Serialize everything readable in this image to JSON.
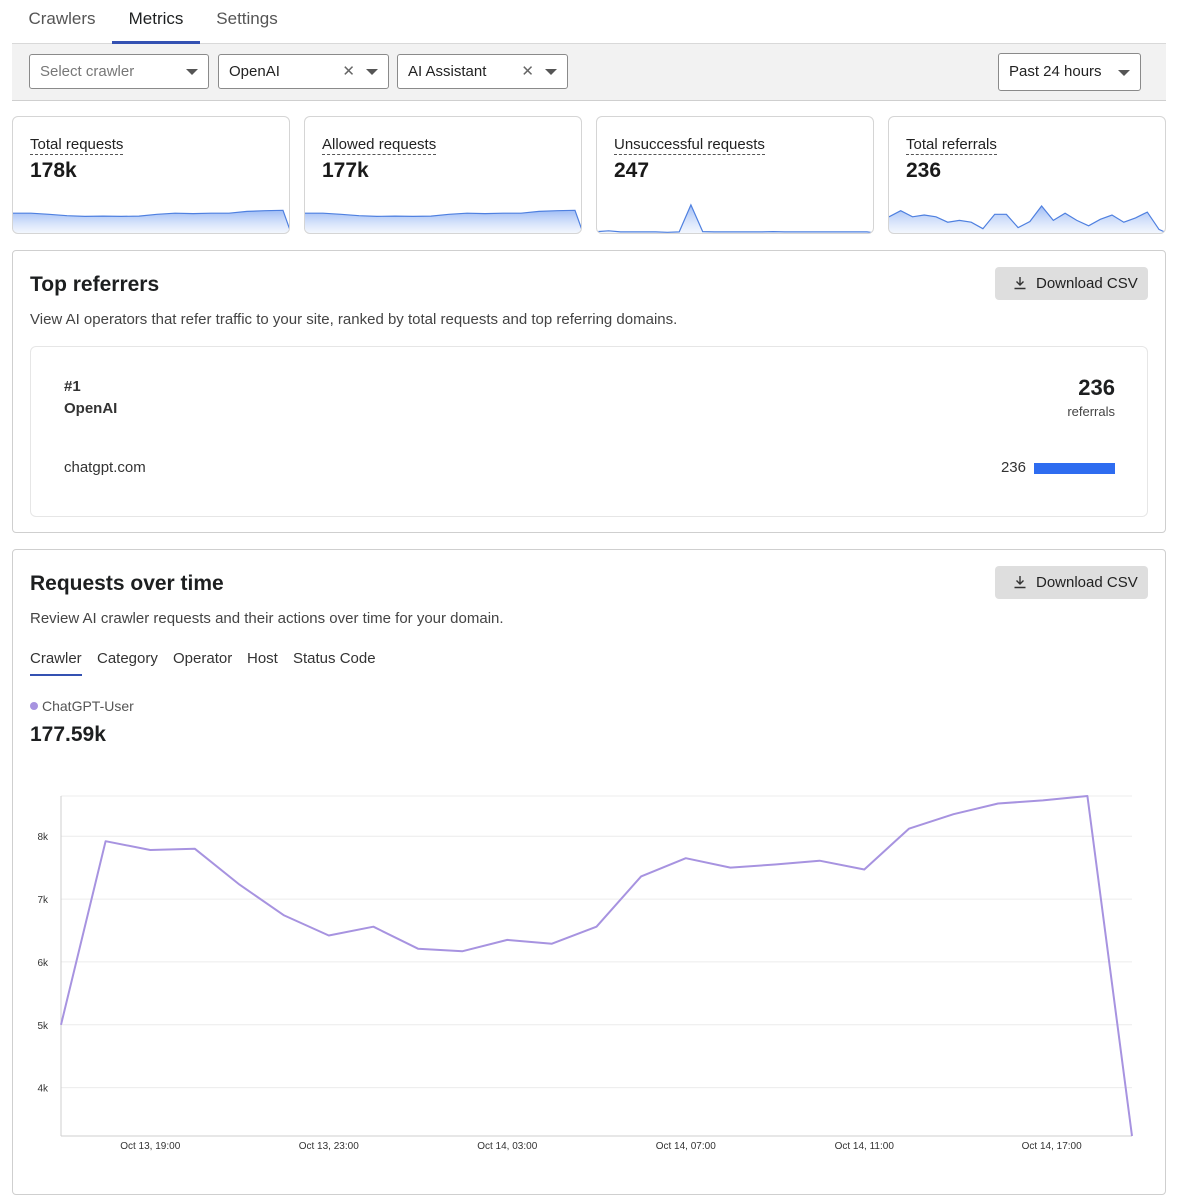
{
  "tabs": [
    {
      "label": "Crawlers",
      "active": false
    },
    {
      "label": "Metrics",
      "active": true
    },
    {
      "label": "Settings",
      "active": false
    }
  ],
  "filters": {
    "crawler": {
      "placeholder": "Select crawler"
    },
    "operator": {
      "value": "OpenAI"
    },
    "category": {
      "value": "AI Assistant"
    },
    "timerange": {
      "value": "Past 24 hours"
    }
  },
  "stats": [
    {
      "label": "Total requests",
      "value": "178k",
      "spark": [
        0.55,
        0.55,
        0.52,
        0.48,
        0.46,
        0.47,
        0.46,
        0.47,
        0.52,
        0.55,
        0.54,
        0.55,
        0.55,
        0.6,
        0.62,
        0.63
      ]
    },
    {
      "label": "Allowed requests",
      "value": "177k",
      "spark": [
        0.55,
        0.55,
        0.52,
        0.48,
        0.46,
        0.47,
        0.46,
        0.47,
        0.52,
        0.55,
        0.54,
        0.55,
        0.55,
        0.6,
        0.62,
        0.63
      ]
    },
    {
      "label": "Unsuccessful requests",
      "value": "247",
      "spark": [
        0.04,
        0.06,
        0.03,
        0.03,
        0.03,
        0.03,
        0.02,
        0.03,
        0.78,
        0.04,
        0.03,
        0.03,
        0.03,
        0.03,
        0.03,
        0.04,
        0.03,
        0.03,
        0.03,
        0.03,
        0.03,
        0.03,
        0.03,
        0.03
      ]
    },
    {
      "label": "Total referrals",
      "value": "236",
      "spark": [
        0.45,
        0.62,
        0.45,
        0.5,
        0.45,
        0.3,
        0.35,
        0.3,
        0.12,
        0.52,
        0.52,
        0.15,
        0.32,
        0.75,
        0.35,
        0.55,
        0.35,
        0.2,
        0.38,
        0.5,
        0.3,
        0.42,
        0.58,
        0.1
      ]
    }
  ],
  "top_referrers": {
    "title": "Top referrers",
    "description": "View AI operators that refer traffic to your site, ranked by total requests and top referring domains.",
    "download_label": "Download CSV",
    "rank": "#1",
    "operator": "OpenAI",
    "total": "236",
    "total_unit": "referrals",
    "domains": [
      {
        "name": "chatgpt.com",
        "count": "236",
        "fraction": 1.0
      }
    ]
  },
  "requests_over_time": {
    "title": "Requests over time",
    "description": "Review AI crawler requests and their actions over time for your domain.",
    "download_label": "Download CSV",
    "subtabs": [
      {
        "label": "Crawler",
        "active": true
      },
      {
        "label": "Category",
        "active": false
      },
      {
        "label": "Operator",
        "active": false
      },
      {
        "label": "Host",
        "active": false
      },
      {
        "label": "Status Code",
        "active": false
      }
    ],
    "legend": {
      "name": "ChatGPT-User",
      "total": "177.59k",
      "color": "#a793e0"
    }
  },
  "chart_data": {
    "type": "line",
    "x": [
      "Oct 13, 17:00",
      "Oct 13, 18:00",
      "Oct 13, 19:00",
      "Oct 13, 20:00",
      "Oct 13, 21:00",
      "Oct 13, 22:00",
      "Oct 13, 23:00",
      "Oct 14, 00:00",
      "Oct 14, 01:00",
      "Oct 14, 02:00",
      "Oct 14, 03:00",
      "Oct 14, 04:00",
      "Oct 14, 05:00",
      "Oct 14, 06:00",
      "Oct 14, 07:00",
      "Oct 14, 08:00",
      "Oct 14, 09:00",
      "Oct 14, 10:00",
      "Oct 14, 11:00",
      "Oct 14, 12:00",
      "Oct 14, 13:00",
      "Oct 14, 14:00",
      "Oct 14, 15:00",
      "Oct 14, 16:00",
      "Oct 14, 17:00"
    ],
    "series": [
      {
        "name": "ChatGPT-User",
        "values": [
          5000,
          7920,
          7780,
          7800,
          7230,
          6740,
          6420,
          6560,
          6210,
          6170,
          6350,
          6290,
          6560,
          7360,
          7650,
          7500,
          7550,
          7610,
          7470,
          8120,
          8350,
          8520,
          8570,
          8640,
          3230
        ]
      }
    ],
    "y_ticks": [
      "4k",
      "5k",
      "6k",
      "7k",
      "8k"
    ],
    "ylim": [
      3230,
      8640
    ],
    "x_tick_labels": [
      {
        "label": "Oct 13, 19:00",
        "index": 2
      },
      {
        "label": "Oct 13, 23:00",
        "index": 6
      },
      {
        "label": "Oct 14, 03:00",
        "index": 10
      },
      {
        "label": "Oct 14, 07:00",
        "index": 14
      },
      {
        "label": "Oct 14, 11:00",
        "index": 18
      },
      {
        "label": "Oct 14, 17:00",
        "index": 22.2
      }
    ],
    "grid": true,
    "color": "#a793e0"
  }
}
